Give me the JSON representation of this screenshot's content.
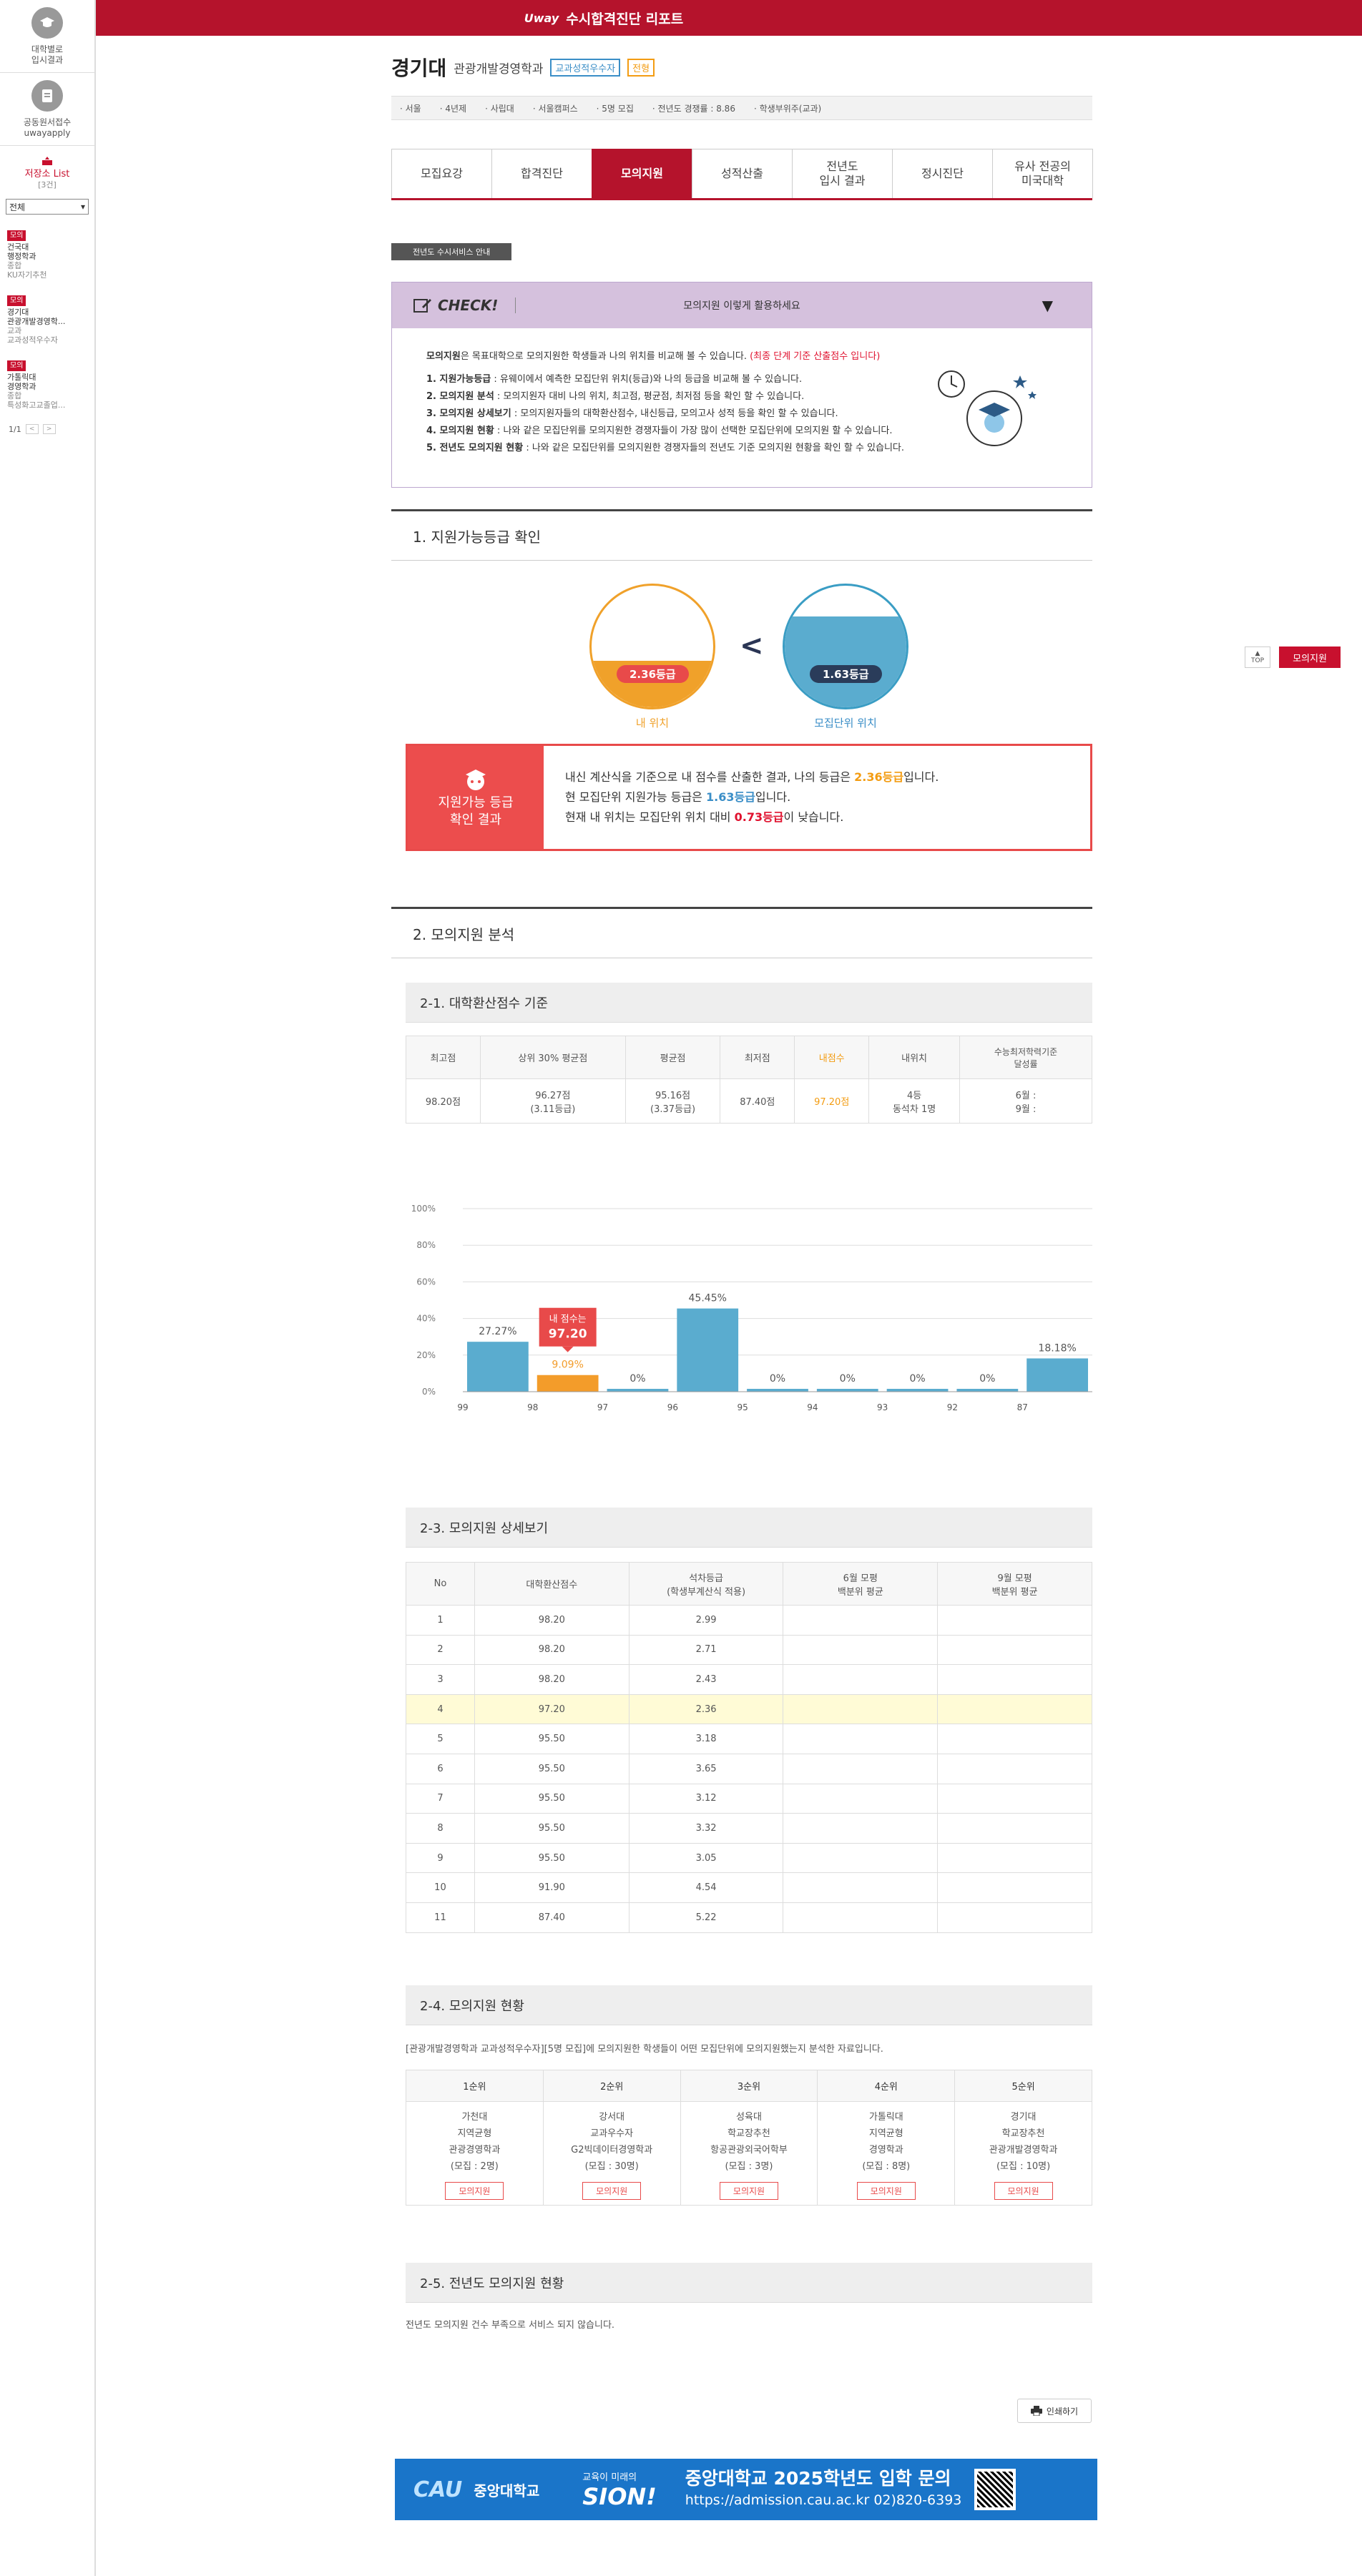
{
  "sidebar": {
    "item1": {
      "line1": "대학별로",
      "line2": "입시결과"
    },
    "item2": {
      "line1": "공동원서접수",
      "line2": "uwayapply"
    },
    "save_title": "저장소 List",
    "save_count": "[3건]",
    "filter": "전체",
    "entries": [
      {
        "tag": "모의",
        "l1": "건국대",
        "l2": "행정학과",
        "l3": "종합",
        "l4": "KU자기추천"
      },
      {
        "tag": "모의",
        "l1": "경기대",
        "l2": "관광개발경영학...",
        "l3": "교과",
        "l4": "교과성적우수자"
      },
      {
        "tag": "모의",
        "l1": "가톨릭대",
        "l2": "경영학과",
        "l3": "종합",
        "l4": "특성화고교졸업..."
      }
    ],
    "page": "1/1"
  },
  "topbar": {
    "logo": "Uway",
    "title": "수시합격진단 리포트"
  },
  "header": {
    "univ": "경기대",
    "dept": "관광개발경영학과",
    "tag1": "교과성적우수자",
    "tag2": "전형",
    "info": [
      "· 서울",
      "· 4년제",
      "· 사립대",
      "· 서울캠퍼스",
      "· 5명 모집",
      "· 전년도 경쟁률 : 8.86",
      "· 학생부위주(교과)"
    ]
  },
  "tabs": [
    "모집요강",
    "합격진단",
    "모의지원",
    "성적산출",
    "전년도\n입시 결과",
    "정시진단",
    "유사 전공의\n미국대학"
  ],
  "prev_service": "전년도 수시서비스 안내",
  "check": {
    "label": "CHECK!",
    "title": "모의지원 이렇게 활용하세요",
    "intro_b": "모의지원",
    "intro": "은 목표대학으로 모의지원한 학생들과 나의 위치를 비교해 볼 수 있습니다.",
    "intro_red": "(최종 단계 기준 산출점수 입니다)",
    "items": [
      {
        "b": "1. 지원가능등급",
        "t": " : 유웨이에서 예측한 모집단위 위치(등급)와 나의 등급을 비교해 볼 수 있습니다."
      },
      {
        "b": "2. 모의지원 분석",
        "t": " : 모의지원자 대비 나의 위치, 최고점, 평균점, 최저점 등을 확인 할 수 있습니다."
      },
      {
        "b": "3. 모의지원 상세보기",
        "t": " : 모의지원자들의 대학환산점수, 내신등급, 모의고사 성적 등을 확인 할 수 있습니다."
      },
      {
        "b": "4. 모의지원 현황",
        "t": " : 나와 같은 모집단위를 모의지원한 경쟁자들이 가장 많이 선택한 모집단위에 모의지원 할 수 있습니다."
      },
      {
        "b": "5. 전년도 모의지원 현황",
        "t": " : 나와 같은 모집단위를 모의지원한 경쟁자들의 전년도 기준 모의지원 현황을 확인 할 수 있습니다."
      }
    ]
  },
  "sec1": {
    "title": "1. 지원가능등급 확인",
    "my_grade": "2.36등급",
    "my_label": "내 위치",
    "my_fill": 0.38,
    "unit_grade": "1.63등급",
    "unit_label": "모집단위 위치",
    "unit_fill": 0.75,
    "result_title1": "지원가능 등급",
    "result_title2": "확인 결과",
    "line1_a": "내신 계산식을 기준으로 내 점수를 산출한 결과, 나의 등급은 ",
    "line1_v": "2.36등급",
    "line1_b": "입니다.",
    "line2_a": "현 모집단위 지원가능 등급은 ",
    "line2_v": "1.63등급",
    "line2_b": "입니다.",
    "line3_a": "현재 내 위치는 모집단위 위치 대비 ",
    "line3_v": "0.73등급",
    "line3_b": "이 낮습니다."
  },
  "sec2": {
    "title": "2. 모의지원 분석",
    "s21": "2-1. 대학환산점수 기준",
    "score_headers": [
      "최고점",
      "상위 30% 평균점",
      "평균점",
      "최저점",
      "내점수",
      "내위치",
      "수능최저학력기준\n달성률"
    ],
    "score_values": [
      "98.20점",
      "96.27점\n(3.11등급)",
      "95.16점\n(3.37등급)",
      "87.40점",
      "97.20점",
      "4등\n동석차 1명",
      "6월 :\n9월 :"
    ],
    "s23": "2-3. 모의지원 상세보기",
    "detail_headers": [
      "No",
      "대학환산점수",
      "석차등급\n(학생부계산식 적용)",
      "6월 모평\n백분위 평균",
      "9월 모평\n백분위 평균"
    ],
    "detail_rows": [
      [
        "1",
        "98.20",
        "2.99",
        "",
        ""
      ],
      [
        "2",
        "98.20",
        "2.71",
        "",
        ""
      ],
      [
        "3",
        "98.20",
        "2.43",
        "",
        ""
      ],
      [
        "4",
        "97.20",
        "2.36",
        "",
        ""
      ],
      [
        "5",
        "95.50",
        "3.18",
        "",
        ""
      ],
      [
        "6",
        "95.50",
        "3.65",
        "",
        ""
      ],
      [
        "7",
        "95.50",
        "3.12",
        "",
        ""
      ],
      [
        "8",
        "95.50",
        "3.32",
        "",
        ""
      ],
      [
        "9",
        "95.50",
        "3.05",
        "",
        ""
      ],
      [
        "10",
        "91.90",
        "4.54",
        "",
        ""
      ],
      [
        "11",
        "87.40",
        "5.22",
        "",
        ""
      ]
    ],
    "s24": "2-4. 모의지원 현황",
    "s24_note": "[관광개발경영학과 교과성적우수자][5명 모집]에 모의지원한 학생들이 어떤 모집단위에 모의지원했는지 분석한 자료입니다.",
    "ranks": [
      {
        "h": "1순위",
        "l1": "가천대",
        "l2": "지역균형",
        "l3": "관광경영학과",
        "l4": "(모집 : 2명)"
      },
      {
        "h": "2순위",
        "l1": "강서대",
        "l2": "교과우수자",
        "l3": "G2빅데이터경영학과",
        "l4": "(모집 : 30명)"
      },
      {
        "h": "3순위",
        "l1": "성육대",
        "l2": "학교장추천",
        "l3": "항공관광외국어학부",
        "l4": "(모집 : 3명)"
      },
      {
        "h": "4순위",
        "l1": "가톨릭대",
        "l2": "지역균형",
        "l3": "경영학과",
        "l4": "(모집 : 8명)"
      },
      {
        "h": "5순위",
        "l1": "경기대",
        "l2": "학교장추천",
        "l3": "관광개발경영학과",
        "l4": "(모집 : 10명)"
      }
    ],
    "rank_btn": "모의지원",
    "s25": "2-5. 전년도 모의지원 현황",
    "s25_note": "전년도 모의지원 건수 부족으로 서비스 되지 않습니다."
  },
  "chart_data": {
    "type": "bar",
    "categories": [
      "99",
      "98",
      "97",
      "96",
      "95",
      "94",
      "93",
      "92",
      "87"
    ],
    "values": [
      27.27,
      9.09,
      0,
      45.45,
      0,
      0,
      0,
      0,
      18.18
    ],
    "value_labels": [
      "27.27%",
      "9.09%",
      "0%",
      "45.45%",
      "0%",
      "0%",
      "0%",
      "0%",
      "18.18%"
    ],
    "yticks": [
      "100%",
      "80%",
      "60%",
      "40%",
      "20%",
      "0%"
    ],
    "ylim": [
      0,
      100
    ],
    "highlight_index": 1,
    "callout_line1": "내 점수는",
    "callout_line2": "97.20",
    "colors": {
      "bar": "#5aaccf",
      "highlight": "#f39c2a",
      "callout": "#e84a4a"
    }
  },
  "print_label": "인쇄하기",
  "banner": {
    "cau": "CAU",
    "univ": "중앙대학교",
    "slogan1": "교육이 미래의",
    "slogan2": "SION!",
    "title": "중앙대학교 2025학년도 입학 문의",
    "url": "https://admission.cau.ac.kr 02)820-6393"
  },
  "floating": {
    "top": "TOP",
    "mock": "모의지원"
  }
}
